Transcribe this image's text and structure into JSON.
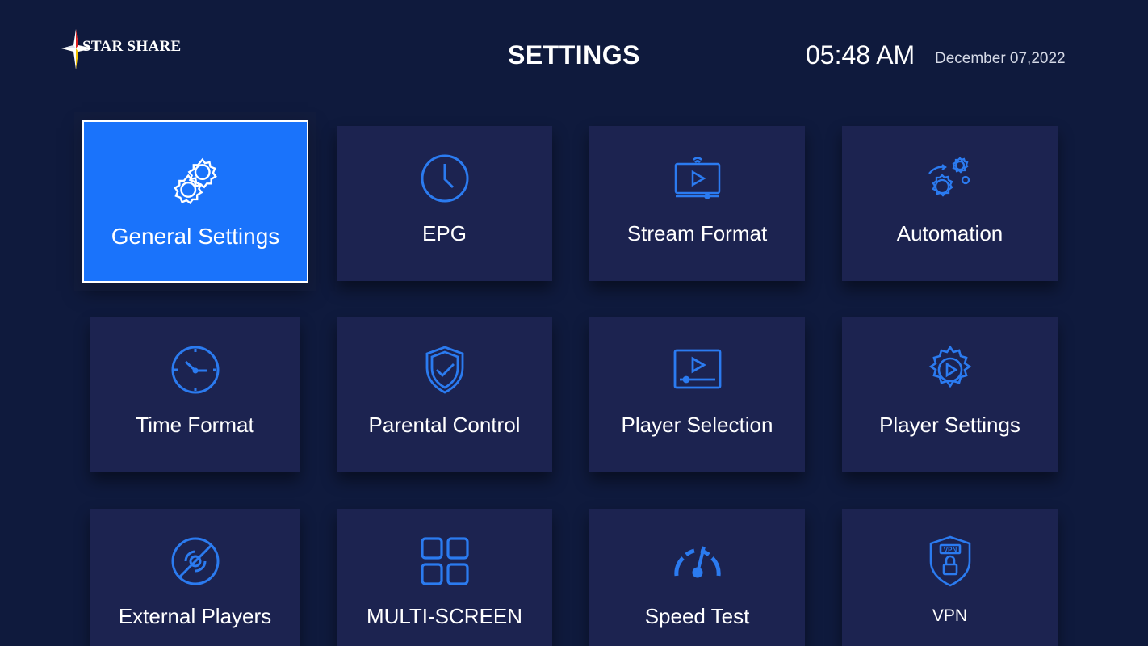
{
  "header": {
    "logo_text": "STAR SHARE",
    "title": "SETTINGS",
    "time": "05:48 AM",
    "date": "December 07,2022"
  },
  "colors": {
    "background": "#0f1a3d",
    "tile": "#1c2350",
    "selected_tile": "#1a73fb",
    "icon": "#2b7bf0"
  },
  "tiles": [
    {
      "label": "General Settings",
      "icon": "gears-icon",
      "selected": true
    },
    {
      "label": "EPG",
      "icon": "clock-icon"
    },
    {
      "label": "Stream Format",
      "icon": "stream-screen-icon"
    },
    {
      "label": "Automation",
      "icon": "automation-gears-icon"
    },
    {
      "label": "Time Format",
      "icon": "time-clock-icon"
    },
    {
      "label": "Parental Control",
      "icon": "shield-check-icon"
    },
    {
      "label": "Player Selection",
      "icon": "video-player-icon"
    },
    {
      "label": "Player Settings",
      "icon": "gear-play-icon"
    },
    {
      "label": "External Players",
      "icon": "external-disc-icon"
    },
    {
      "label": "MULTI-SCREEN",
      "icon": "grid-icon"
    },
    {
      "label": "Speed Test",
      "icon": "speedometer-icon"
    },
    {
      "label": "VPN",
      "icon": "vpn-lock-icon"
    }
  ]
}
